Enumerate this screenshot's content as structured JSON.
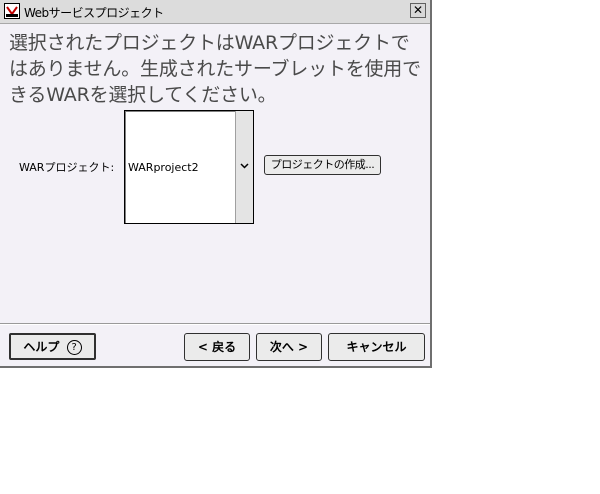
{
  "window": {
    "title": "Webサービスプロジェクト",
    "close_label": "✕"
  },
  "message": {
    "text": "選択されたプロジェクトはWARプロジェクトではありません。生成されたサーブレットを使用できるWARを選択してください。"
  },
  "war_project": {
    "label": "WARプロジェクト:",
    "selected_value": "WARproject2",
    "create_button_label": "プロジェクトの作成..."
  },
  "footer": {
    "help_label": "ヘルプ",
    "help_icon_glyph": "?",
    "back_label": "< 戻る",
    "next_label": "次へ >",
    "cancel_label": "キャンセル"
  }
}
